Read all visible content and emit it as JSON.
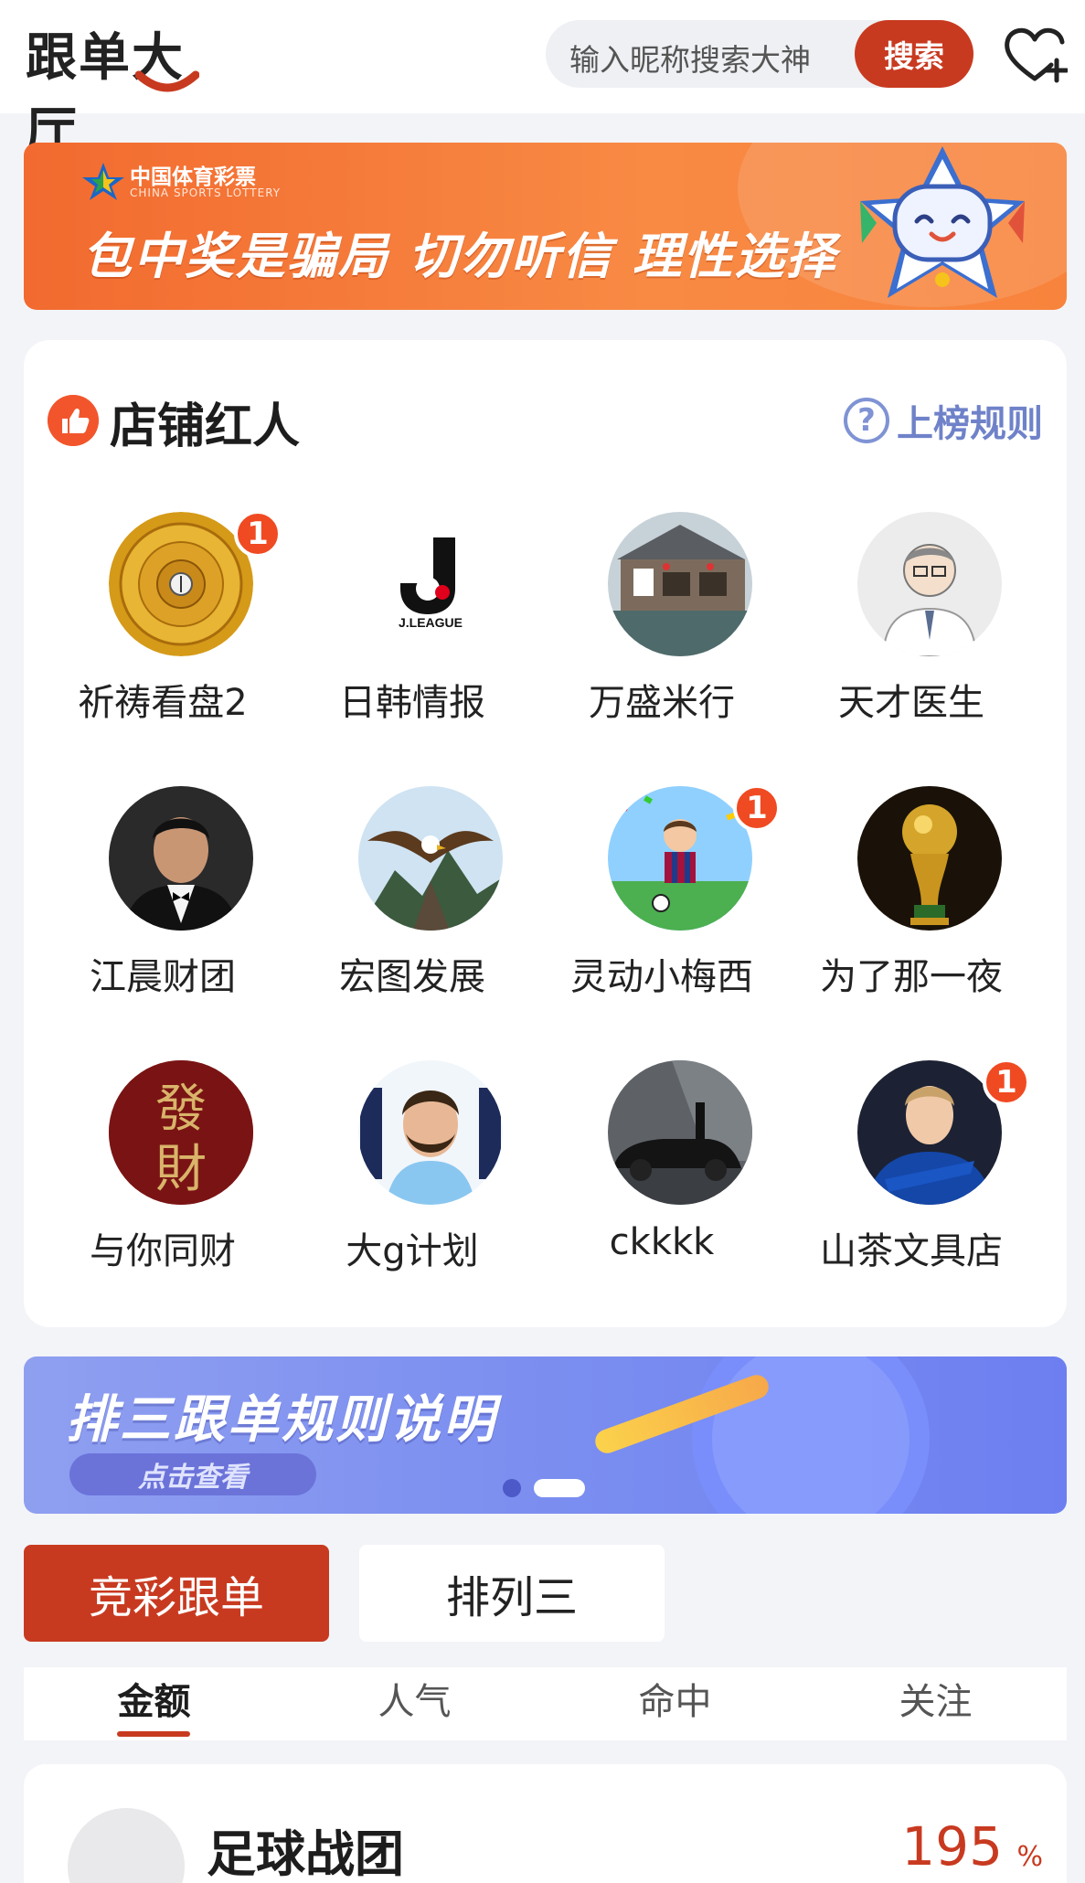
{
  "header": {
    "logo_text": "跟单大厅",
    "search_placeholder": "输入昵称搜索大神",
    "search_button": "搜索",
    "follow_icon": "heart-plus-icon"
  },
  "lottery_banner": {
    "org_name": "中国体育彩票",
    "org_name_en": "CHINA SPORTS LOTTERY",
    "slogan": "包中奖是骗局 切勿听信 理性选择"
  },
  "influencers": {
    "title": "店铺红人",
    "rules_link": "上榜规则",
    "items": [
      {
        "name": "祈祷看盘2",
        "badge": "1"
      },
      {
        "name": "日韩情报",
        "badge": ""
      },
      {
        "name": "万盛米行",
        "badge": ""
      },
      {
        "name": "天才医生",
        "badge": ""
      },
      {
        "name": "江晨财团",
        "badge": ""
      },
      {
        "name": "宏图发展",
        "badge": ""
      },
      {
        "name": "灵动小梅西",
        "badge": "1"
      },
      {
        "name": "为了那一夜",
        "badge": ""
      },
      {
        "name": "与你同财",
        "badge": ""
      },
      {
        "name": "大g计划",
        "badge": ""
      },
      {
        "name": "ckkkk",
        "badge": ""
      },
      {
        "name": "山茶文具店",
        "badge": "1"
      }
    ],
    "avatar_texts": {
      "jleague": "J.LEAGUE",
      "fa": "發",
      "cai": "財"
    }
  },
  "rules_banner": {
    "title": "排三跟单规则说明",
    "cta": "点击查看"
  },
  "category_tabs": [
    "竞彩跟单",
    "排列三"
  ],
  "sort_tabs": [
    "金额",
    "人气",
    "命中",
    "关注"
  ],
  "list": {
    "name": "足球战团",
    "rate": "195",
    "unit": "%"
  },
  "colors": {
    "accent": "#c83a20",
    "lottery_orange": "#f26a2f",
    "rules_blue": "#7b8ef0",
    "rules_link": "#6f82c9"
  }
}
